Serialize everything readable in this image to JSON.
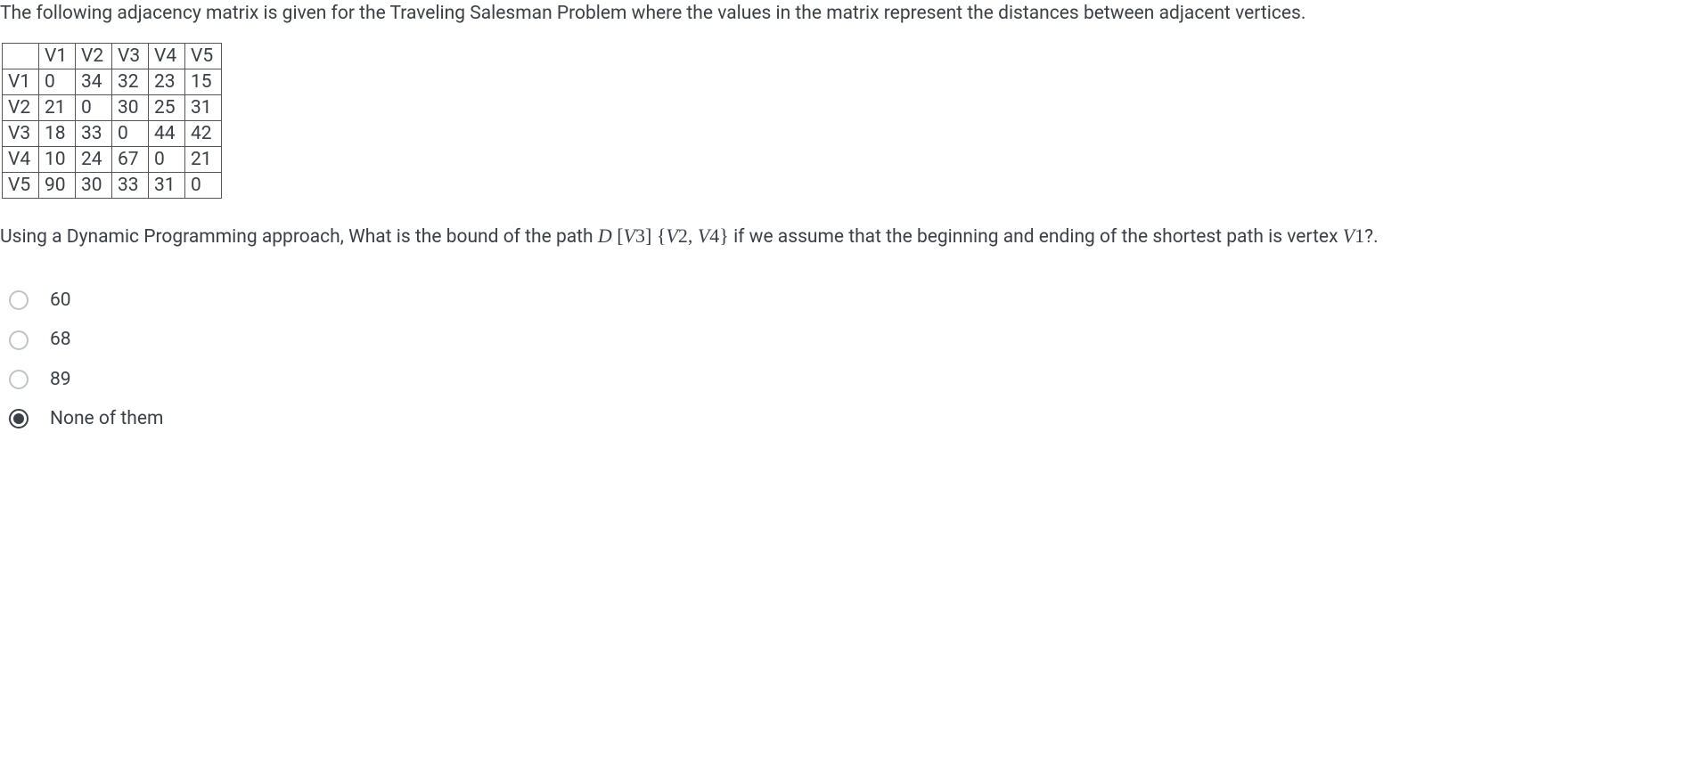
{
  "question": {
    "intro": "The following adjacency matrix is given for the Traveling Salesman Problem where the values in the matrix represent the distances between adjacent vertices.",
    "sub_part1": "Using a Dynamic Programming approach, What is the bound of the path ",
    "sub_mathD": "D",
    "sub_bracket_open": " [",
    "sub_v3": "V",
    "sub_v3n": "3",
    "sub_bracket_close": "] ",
    "sub_set_open": "{",
    "sub_v2": "V",
    "sub_v2n": "2",
    "sub_comma": ", ",
    "sub_v4": "V",
    "sub_v4n": "4",
    "sub_set_close": "}",
    "sub_part2": " if we assume that the beginning and ending of the shortest path is vertex ",
    "sub_v1": "V",
    "sub_v1n": "1",
    "sub_qmark": "?."
  },
  "matrix": {
    "headers": [
      "",
      "V1",
      "V2",
      "V3",
      "V4",
      "V5"
    ],
    "rows": [
      {
        "label": "V1",
        "cells": [
          "0",
          "34",
          "32",
          "23",
          "15"
        ]
      },
      {
        "label": "V2",
        "cells": [
          "21",
          "0",
          "30",
          "25",
          "31"
        ]
      },
      {
        "label": "V3",
        "cells": [
          "18",
          "33",
          "0",
          "44",
          "42"
        ]
      },
      {
        "label": "V4",
        "cells": [
          "10",
          "24",
          "67",
          "0",
          "21"
        ]
      },
      {
        "label": "V5",
        "cells": [
          "90",
          "30",
          "33",
          "31",
          "0"
        ]
      }
    ]
  },
  "options": [
    {
      "label": "60",
      "selected": false
    },
    {
      "label": "68",
      "selected": false
    },
    {
      "label": "89",
      "selected": false
    },
    {
      "label": "None of them",
      "selected": true
    }
  ]
}
